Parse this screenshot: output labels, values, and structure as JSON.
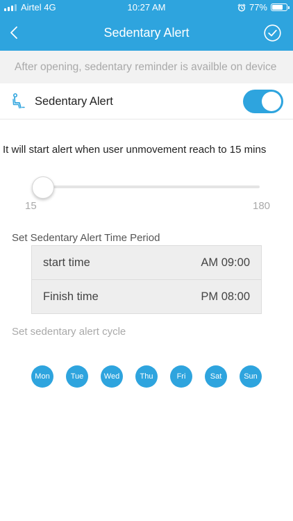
{
  "status_bar": {
    "carrier": "Airtel 4G",
    "time": "10:27 AM",
    "battery": "77%",
    "battery_level": 0.77
  },
  "nav": {
    "title": "Sedentary Alert"
  },
  "notice": {
    "text": "After opening, sedentary reminder is availble on device"
  },
  "alert_row": {
    "label": "Sedentary Alert",
    "enabled": true
  },
  "description": "It will start alert when user unmovement reach to 15 mins",
  "slider": {
    "min_label": "15",
    "max_label": "180",
    "value": 15
  },
  "period": {
    "title": "Set Sedentary Alert Time Period",
    "start_label": "start time",
    "start_value": "AM 09:00",
    "finish_label": "Finish time",
    "finish_value": "PM 08:00"
  },
  "cycle": {
    "title": "Set sedentary alert cycle",
    "days": [
      "Mon",
      "Tue",
      "Wed",
      "Thu",
      "Fri",
      "Sat",
      "Sun"
    ]
  },
  "colors": {
    "accent": "#2ea4de",
    "notice_bg": "#f2f2f2"
  }
}
